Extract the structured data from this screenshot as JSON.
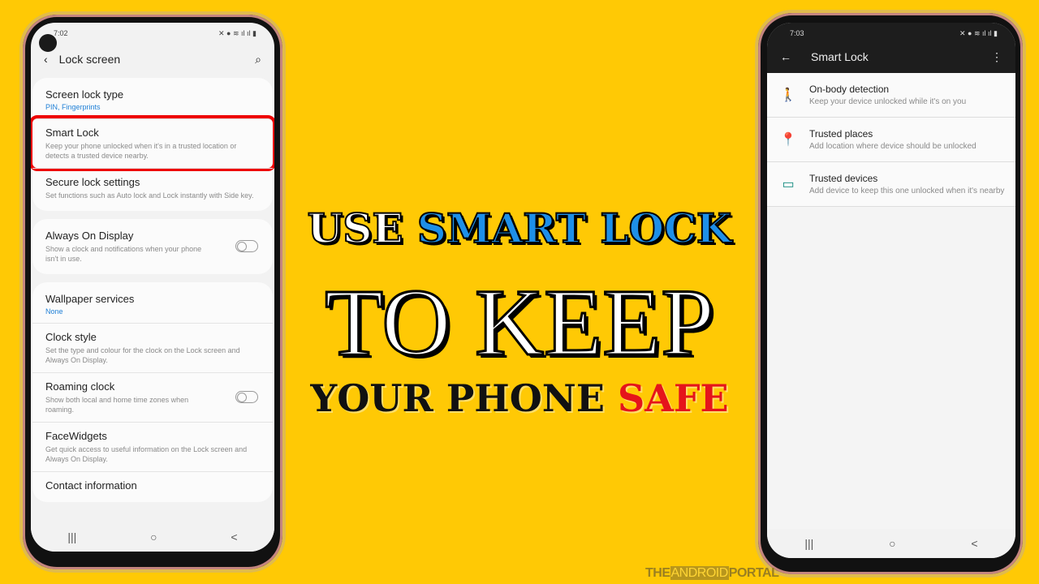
{
  "left_phone": {
    "status_time": "7:02",
    "title": "Lock screen",
    "groups": [
      [
        {
          "title": "Screen lock type",
          "value": "PIN, Fingerprints"
        },
        {
          "title": "Smart Lock",
          "sub": "Keep your phone unlocked when it's in a trusted location or detects a trusted device nearby.",
          "highlighted": true
        },
        {
          "title": "Secure lock settings",
          "sub": "Set functions such as Auto lock and Lock instantly with Side key."
        }
      ],
      [
        {
          "title": "Always On Display",
          "sub": "Show a clock and notifications when your phone isn't in use.",
          "toggle": false
        }
      ],
      [
        {
          "title": "Wallpaper services",
          "value": "None"
        },
        {
          "title": "Clock style",
          "sub": "Set the type and colour for the clock on the Lock screen and Always On Display."
        },
        {
          "title": "Roaming clock",
          "sub": "Show both local and home time zones when roaming.",
          "toggle": false
        },
        {
          "title": "FaceWidgets",
          "sub": "Get quick access to useful information on the Lock screen and Always On Display."
        },
        {
          "title": "Contact information"
        }
      ]
    ],
    "nav": [
      "|||",
      "○",
      "<"
    ]
  },
  "right_phone": {
    "status_time": "7:03",
    "title": "Smart Lock",
    "items": [
      {
        "icon": "walking-person-icon",
        "title": "On-body detection",
        "sub": "Keep your device unlocked while it's on you"
      },
      {
        "icon": "location-pin-icon",
        "title": "Trusted places",
        "sub": "Add location where device should be unlocked"
      },
      {
        "icon": "devices-icon",
        "title": "Trusted devices",
        "sub": "Add device to keep this one unlocked when it's nearby"
      }
    ],
    "nav": [
      "|||",
      "○",
      "<"
    ]
  },
  "headline": {
    "l1a": "USE ",
    "l1b": "SMART LOCK",
    "l2": "TO KEEP",
    "l3a": "YOUR PHONE ",
    "l3b": "SAFE"
  },
  "colors": {
    "background": "#FFC905",
    "blue": "#1E8FE8",
    "red": "#E5141B",
    "highlight": "#EE0000",
    "teal": "#118A7E"
  },
  "watermark": {
    "a": "THE",
    "b": "ANDROID",
    "c": "PORTAL"
  }
}
